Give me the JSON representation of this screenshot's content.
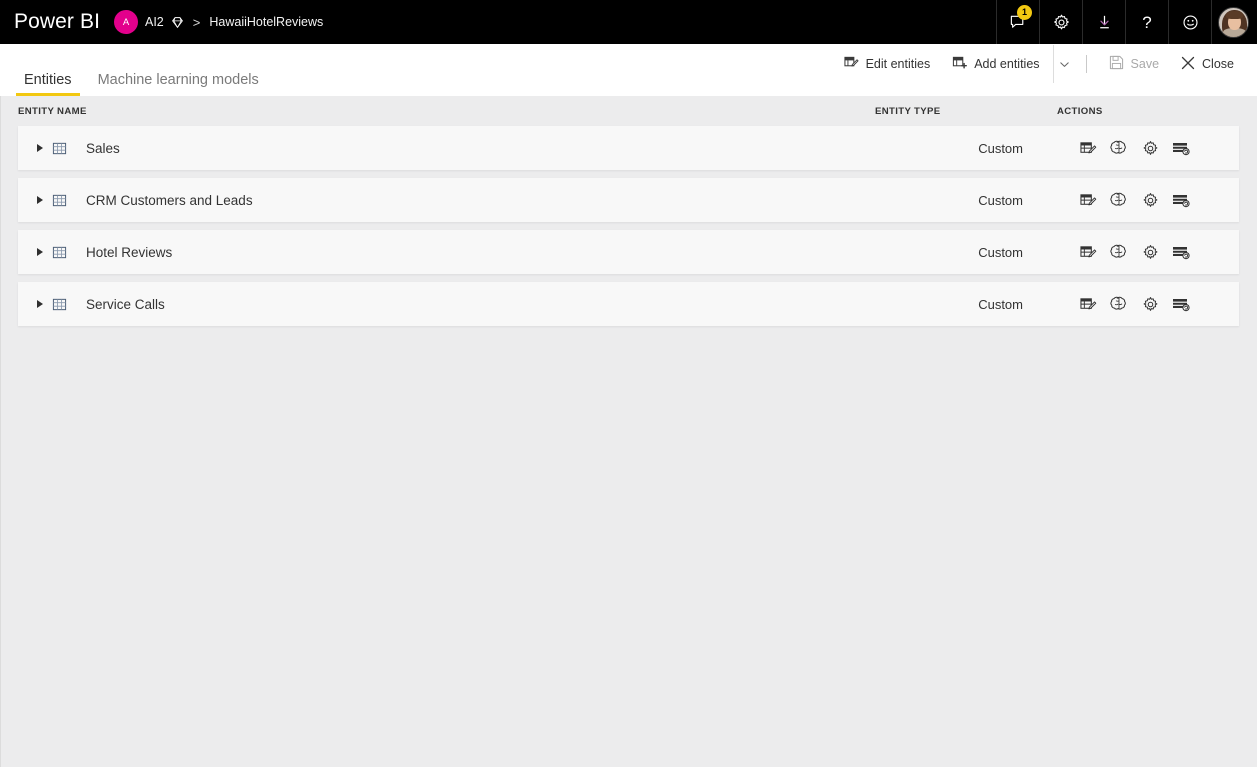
{
  "header": {
    "brand": "Power BI",
    "workspace_initial": "A",
    "workspace_name": "AI2",
    "breadcrumb_separator": ">",
    "dataflow_name": "HawaiiHotelReviews",
    "premium_icon": "diamond-icon",
    "actions": [
      {
        "name": "notifications-button",
        "icon": "speech-bubble-icon",
        "badge": "1"
      },
      {
        "name": "settings-button",
        "icon": "gear-icon",
        "badge": ""
      },
      {
        "name": "download-button",
        "icon": "download-arrow-icon",
        "badge": ""
      },
      {
        "name": "help-button",
        "icon": "question-mark-icon",
        "glyph": "?",
        "badge": ""
      },
      {
        "name": "feedback-button",
        "icon": "smiley-face-icon",
        "badge": ""
      },
      {
        "name": "account-button",
        "icon": "user-avatar-photo",
        "badge": ""
      }
    ]
  },
  "toolbar": {
    "edit_entities": "Edit entities",
    "add_entities": "Add entities",
    "save": "Save",
    "close": "Close",
    "icons": {
      "edit_entities": "table-edit-icon",
      "add_entities": "table-add-icon",
      "add_entities_chevron": "chevron-down-icon",
      "save": "save-disk-icon",
      "close": "close-x-icon"
    }
  },
  "tabs": [
    {
      "label": "Entities",
      "active": true
    },
    {
      "label": "Machine learning models",
      "active": false
    }
  ],
  "table": {
    "columns": {
      "entity_name": "ENTITY NAME",
      "entity_type": "ENTITY TYPE",
      "actions": "ACTIONS"
    },
    "row_action_icons": [
      "edit-entity-icon",
      "brain-ai-icon",
      "entity-settings-gear-icon",
      "incremental-refresh-icon"
    ],
    "rows": [
      {
        "name": "Sales",
        "type": "Custom",
        "icon": "table-icon",
        "expander": "chevron-right-icon"
      },
      {
        "name": "CRM Customers and Leads",
        "type": "Custom",
        "icon": "table-icon",
        "expander": "chevron-right-icon"
      },
      {
        "name": "Hotel Reviews",
        "type": "Custom",
        "icon": "table-icon",
        "expander": "chevron-right-icon"
      },
      {
        "name": "Service Calls",
        "type": "Custom",
        "icon": "table-icon",
        "expander": "chevron-right-icon"
      }
    ]
  },
  "colors": {
    "topbar_bg": "#000000",
    "accent_yellow": "#f2c811",
    "workspace_avatar": "#e3008c",
    "page_bg": "#ececed",
    "row_bg": "#f8f8f8"
  }
}
